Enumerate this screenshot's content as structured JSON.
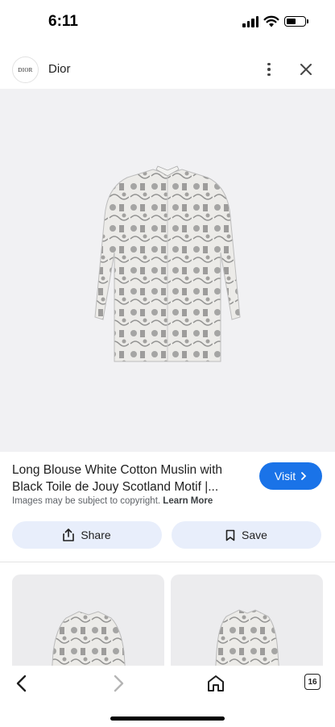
{
  "status_bar": {
    "time": "6:11"
  },
  "header": {
    "logo_text": "DIOR",
    "site_name": "Dior"
  },
  "result": {
    "title": "Long Blouse White Cotton Muslin with Black Toile de Jouy Scotland Motif |...",
    "visit_label": "Visit",
    "copyright_text": "Images may be subject to copyright.",
    "learn_more": "Learn More"
  },
  "actions": {
    "share_label": "Share",
    "save_label": "Save"
  },
  "bottom_nav": {
    "tab_count": "16"
  },
  "colors": {
    "accent": "#1a73e8",
    "action_bg": "#e8eefb",
    "image_bg": "#f1f1f3"
  }
}
